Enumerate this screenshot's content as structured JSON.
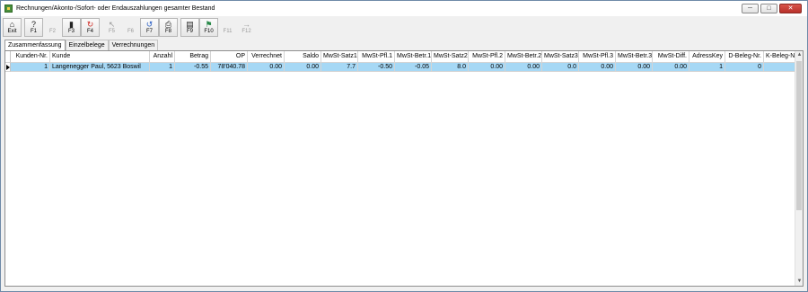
{
  "window": {
    "title": "Rechnungen/Akonto-/Sofort- oder Endauszahlungen gesamter Bestand",
    "min_glyph": "─",
    "max_glyph": "□",
    "close_glyph": "✕"
  },
  "toolbar": {
    "buttons": [
      {
        "label": "Exit",
        "icon": "⌂"
      },
      {
        "label": "F1",
        "icon": "?"
      },
      {
        "label": "F2",
        "icon": ""
      },
      {
        "label": "F3",
        "icon": "▮"
      },
      {
        "label": "F4",
        "icon": "↻"
      },
      {
        "label": "F5",
        "icon": "↖"
      },
      {
        "label": "F6",
        "icon": ""
      },
      {
        "label": "F7",
        "icon": "↺"
      },
      {
        "label": "F8",
        "icon": "⎙"
      },
      {
        "label": "F9",
        "icon": "▤"
      },
      {
        "label": "F10",
        "icon": "⚑"
      },
      {
        "label": "F11",
        "icon": ""
      },
      {
        "label": "F12",
        "icon": "→"
      }
    ]
  },
  "tabs": [
    {
      "label": "Zusammenfassung"
    },
    {
      "label": "Einzelbelege"
    },
    {
      "label": "Verrechnungen"
    }
  ],
  "table": {
    "columns": [
      "Kunden-Nr.",
      "Kunde",
      "Anzahl",
      "Betrag",
      "OP",
      "Verrechnet",
      "Saldo",
      "MwSt-Satz1",
      "MwSt-Pfl.1",
      "MwSt-Betr.1",
      "MwSt-Satz2",
      "MwSt-Pfl.2",
      "MwSt-Betr.2",
      "MwSt-Satz3",
      "MwSt-Pfl.3",
      "MwSt-Betr.3",
      "MwSt-Diff.",
      "AdressKey",
      "D-Beleg-Nr.",
      "K-Beleg-Nr."
    ],
    "rows": [
      [
        "1",
        "Langenegger Paul, 5623 Boswil",
        "1",
        "-0.55",
        "78'040.78",
        "0.00",
        "0.00",
        "7.7",
        "-0.50",
        "-0.05",
        "8.0",
        "0.00",
        "0.00",
        "0.0",
        "0.00",
        "0.00",
        "0.00",
        "1",
        "0",
        ""
      ]
    ]
  },
  "scrollbar": {
    "up_glyph": "▲",
    "down_glyph": "▼"
  }
}
